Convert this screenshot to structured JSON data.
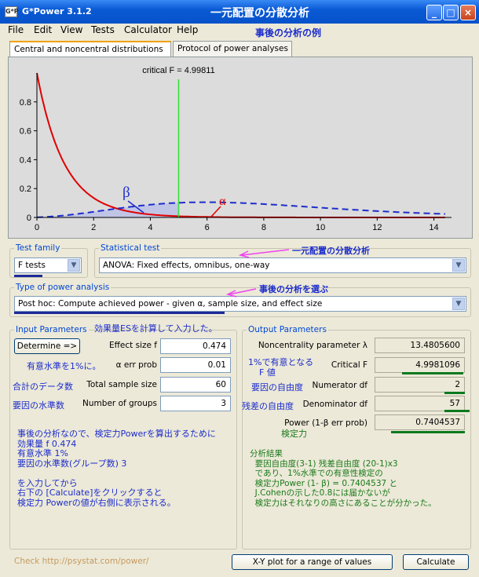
{
  "window": {
    "title": "G*Power 3.1.2",
    "app_icon": "G*P",
    "minimize": "_",
    "maximize": "□",
    "close": "×"
  },
  "annotations": {
    "title_jp": "一元配置の分散分析",
    "subtitle_jp": "事後の分析の例",
    "stat_test_jp": "一元配置の分散分析",
    "analysis_jp": "事後の分析を選ぶ",
    "es_jp": "効果量ESを計算して入力した。",
    "alpha_jp": "有意水準を1%に。",
    "total_jp": "合計のデータ数",
    "groups_jp": "要因の水準数",
    "left_notes": [
      "事後の分析なので、検定力Powerを算出するために",
      "効果量  f   0.474",
      "有意水準    1%",
      "要因の水準数(グループ数) 3",
      "",
      "を入力してから",
      "右下の [Calculate]をクリックすると",
      "検定力 Powerの値が右側に表示される。"
    ],
    "critf_jp_1": "1%で有意となる",
    "critf_jp_2": "F 値",
    "numdf_jp": "要因の自由度",
    "dendf_jp": "残差の自由度",
    "power_jp": "検定力",
    "result_notes": [
      "分析結果",
      "  要因自由度(3-1) 残差自由度 (20-1)x3",
      "  であり、1%水準での有意性検定の",
      "  検定力Power (1- β) = 0.7404537 と",
      "  J.Cohenの示した0.8には届かないが",
      "  検定力はそれなりの高さにあることが分かった。"
    ]
  },
  "menu": [
    "File",
    "Edit",
    "View",
    "Tests",
    "Calculator",
    "Help"
  ],
  "tabs": [
    "Central and noncentral distributions",
    "Protocol of power analyses"
  ],
  "chart": {
    "critical_label": "critical F = 4.99811",
    "beta_label": "β",
    "alpha_label": "α",
    "x_ticks": [
      "0",
      "2",
      "4",
      "6",
      "8",
      "10",
      "12",
      "14"
    ],
    "y_ticks": [
      "0",
      "0.2",
      "0.4",
      "0.6",
      "0.8"
    ]
  },
  "chart_data": {
    "type": "line",
    "title": "critical F = 4.99811",
    "xlim": [
      0,
      14.4
    ],
    "ylim": [
      0,
      1.0
    ],
    "critical_x": 4.99811,
    "series": [
      {
        "name": "",
        "style": "solid",
        "color": "#e00000"
      },
      {
        "name": "",
        "style": "dashed",
        "color": "#1d2dcc"
      }
    ],
    "df1": 2,
    "df2": 57,
    "lambda": 13.48056
  },
  "test_family": {
    "label": "Test family",
    "value": "F tests"
  },
  "statistical_test": {
    "label": "Statistical test",
    "value": "ANOVA: Fixed effects, omnibus, one-way"
  },
  "power_analysis": {
    "label": "Type of power analysis",
    "value": "Post hoc: Compute achieved power - given α, sample size, and effect size"
  },
  "input": {
    "label": "Input Parameters",
    "determine": "Determine =>",
    "effect_size_label": "Effect size f",
    "effect_size": "0.474",
    "alpha_label": "α err prob",
    "alpha": "0.01",
    "total_label": "Total sample size",
    "total": "60",
    "groups_label": "Number of groups",
    "groups": "3"
  },
  "output": {
    "label": "Output Parameters",
    "ncp_label": "Noncentrality parameter λ",
    "ncp": "13.4805600",
    "critf_label": "Critical F",
    "critf": "4.9981096",
    "numdf_label": "Numerator df",
    "numdf": "2",
    "dendf_label": "Denominator df",
    "dendf": "57",
    "power_label": "Power (1-β err prob)",
    "power": "0.7404537"
  },
  "footer": {
    "link": "Check http://psystat.com/power/",
    "xy_button": "X-Y plot for a range of values",
    "calculate": "Calculate"
  }
}
